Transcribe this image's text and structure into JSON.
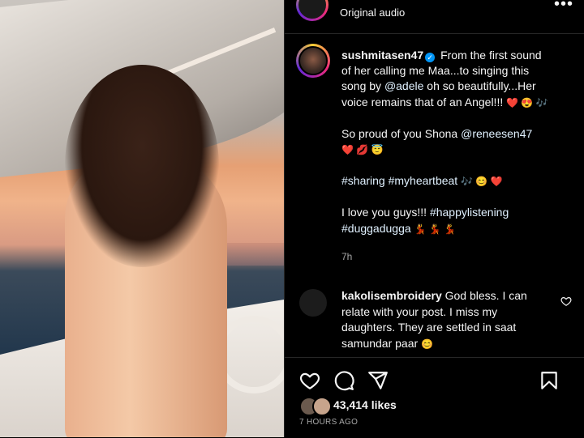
{
  "top": {
    "audio_label": "Original audio",
    "more": "•••"
  },
  "caption": {
    "username": "sushmitasen47",
    "verified_mark": "✓",
    "line1_a": "From the first sound of her calling me Maa...to singing this song by ",
    "mention_adele": "@adele",
    "line1_b": " oh so beautifully...Her voice remains that of an Angel!!! ",
    "emoji1": "❤️ 😍 🎶",
    "line2_a": "So proud of you Shona ",
    "mention_renee": "@reneesen47",
    "emoji2": "❤️ 💋 😇",
    "tags1": "#sharing #myheartbeat",
    "emoji3": "🎶 😊 ❤️",
    "line4_a": "I love you guys!!! ",
    "tag_happy": "#happylistening",
    "tag_dugga": "#duggadugga",
    "emoji4": "💃 💃 💃",
    "time": "7h"
  },
  "comment": {
    "username": "kakolisembroidery",
    "text": " God bless. I can relate with your post. I miss my daughters. They are settled in saat samundar paar ",
    "emoji": "😊"
  },
  "actions": {
    "icons": [
      "heart-icon",
      "comment-icon",
      "share-icon",
      "bookmark-icon"
    ],
    "likes": "43,414 likes",
    "posted": "7 HOURS AGO"
  }
}
